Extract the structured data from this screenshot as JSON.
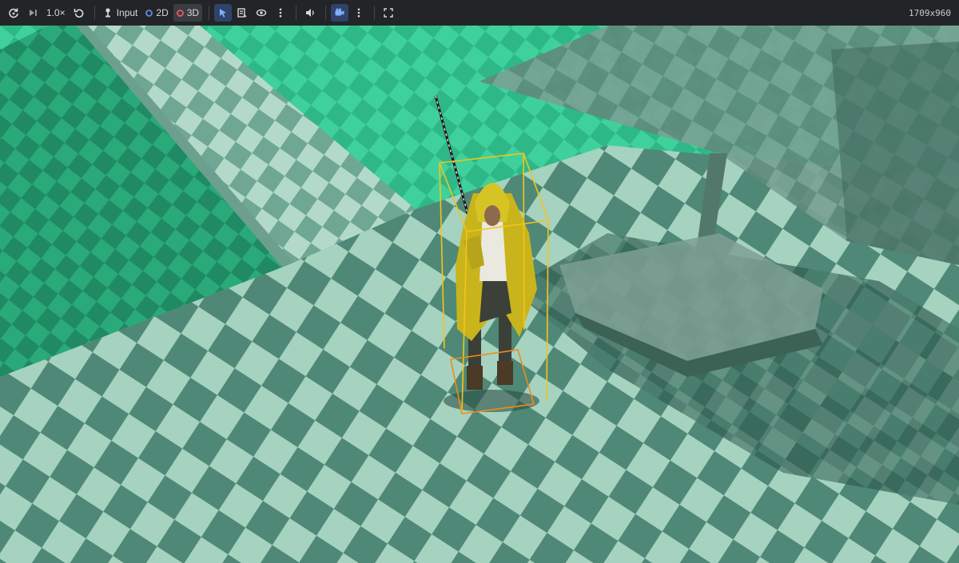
{
  "toolbar": {
    "speed_label": "1.0×",
    "input_label": "Input",
    "mode_2d_label": "2D",
    "mode_3d_label": "3D",
    "resolution": "1709x960",
    "icons": {
      "reload": "reload-icon",
      "step": "step-forward-icon",
      "reset": "reset-icon",
      "input": "joystick-icon",
      "select": "select-cursor-icon",
      "list": "list-icon",
      "visibility": "eye-icon",
      "more": "kebab-menu-icon",
      "audio": "speaker-icon",
      "camera": "camera-icon",
      "fullscreen": "fullscreen-icon"
    },
    "accent": "#2f4368"
  },
  "scene": {
    "floor_colors": [
      "#2fb887",
      "#8fcab2",
      "#3e6e60"
    ],
    "selection_color": "#f3c51a"
  }
}
